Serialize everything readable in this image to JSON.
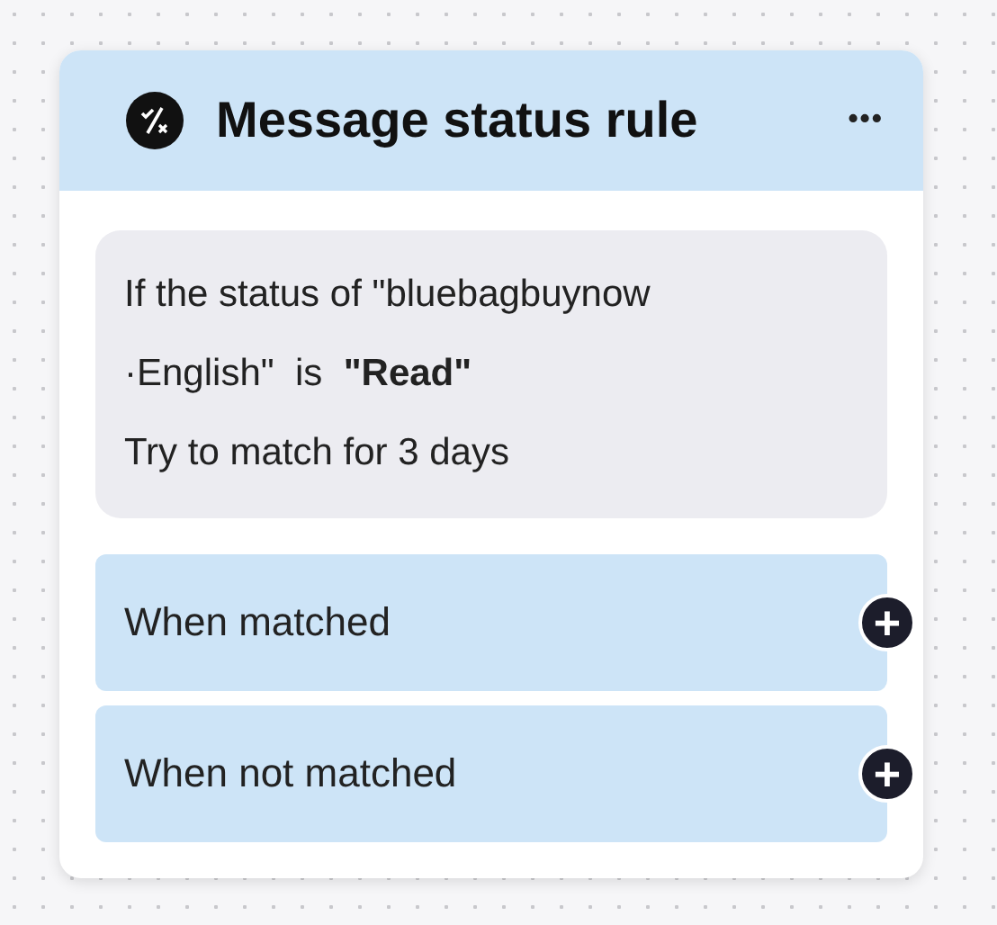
{
  "card": {
    "title": "Message status rule",
    "more": "•••",
    "condition": {
      "lines": [
        "If the status of \"bluebagbuynow",
        "·English\"  is  **\"Read\"**",
        "Try to match for 3 days"
      ]
    },
    "branches": [
      {
        "label": "When matched",
        "add": "+"
      },
      {
        "label": "When not matched",
        "add": "+"
      }
    ]
  }
}
